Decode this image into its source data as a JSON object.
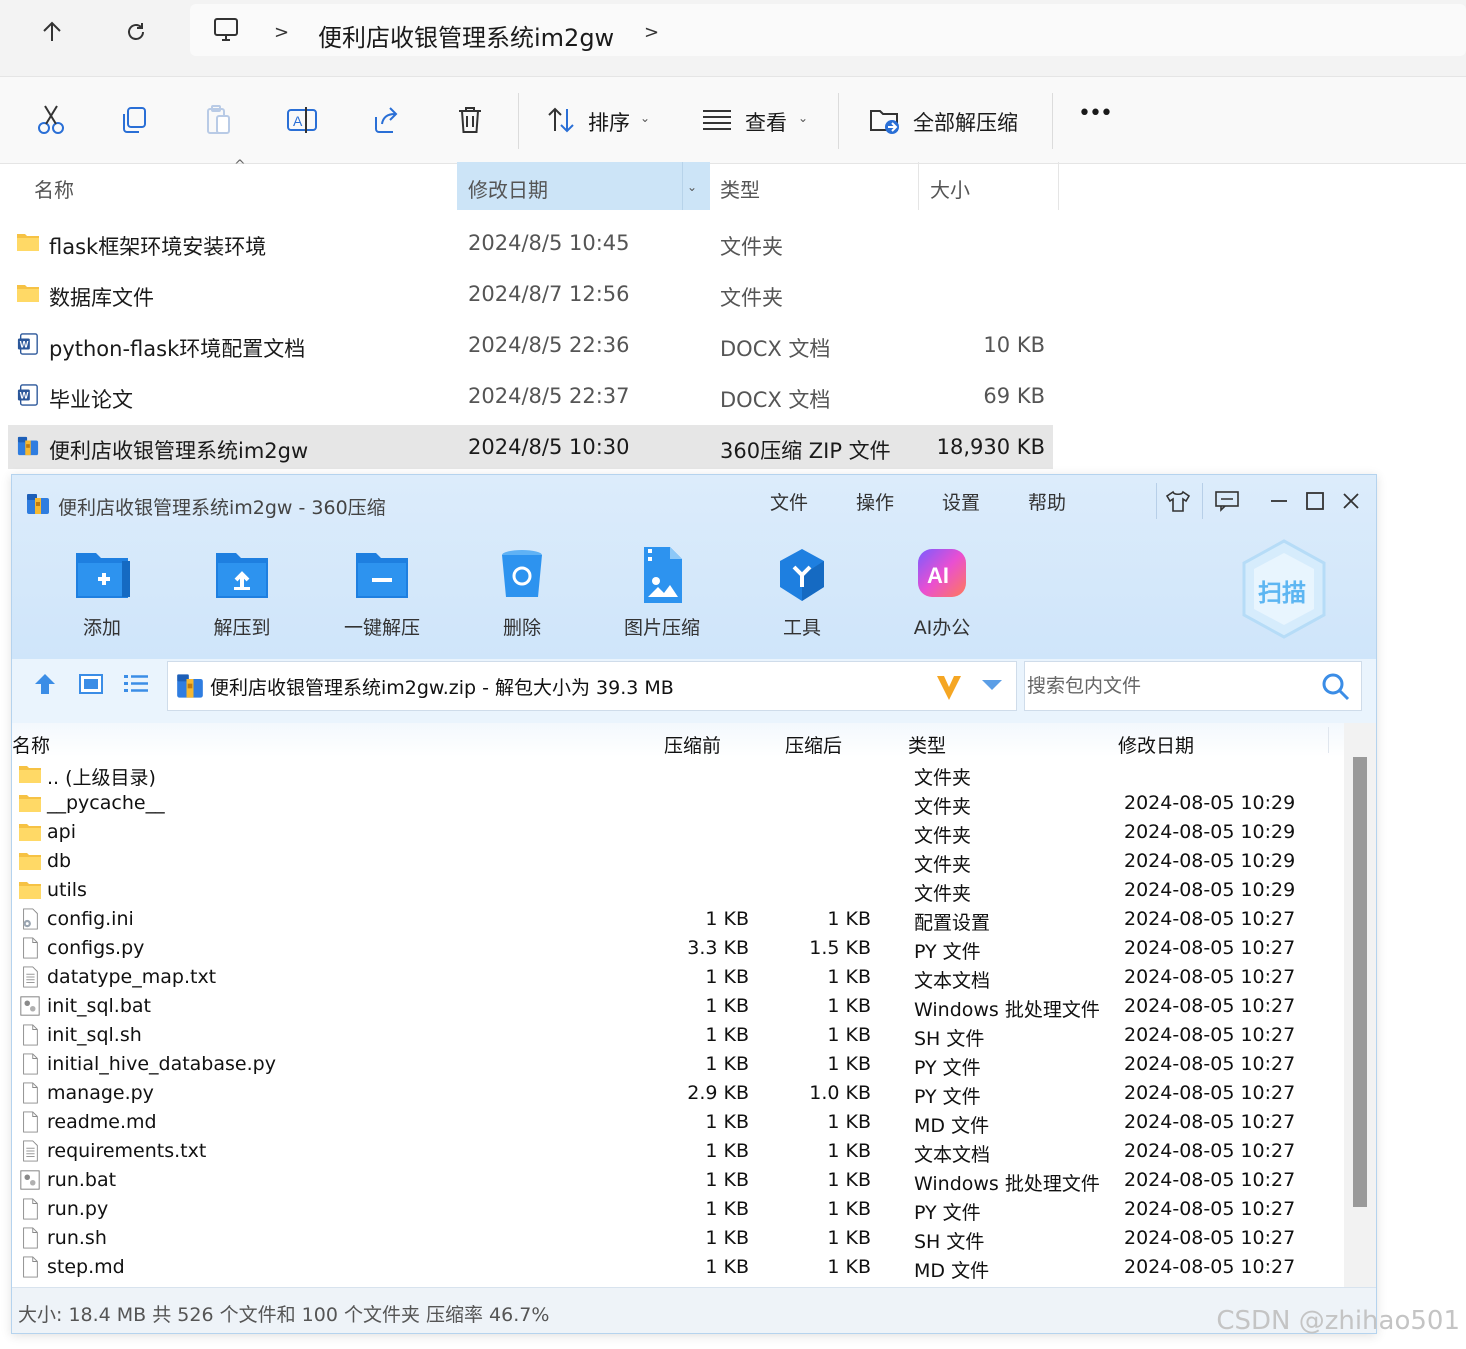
{
  "explorer": {
    "breadcrumb_title": "便利店收银管理系统im2gw",
    "toolbar": {
      "sort_label": "排序",
      "view_label": "查看",
      "extract_all_label": "全部解压缩",
      "more_label": "•••"
    },
    "columns": {
      "name": "名称",
      "date": "修改日期",
      "type": "类型",
      "size": "大小"
    },
    "rows": [
      {
        "name": "flask框架环境安装环境",
        "date": "2024/8/5 10:45",
        "type": "文件夹",
        "size": "",
        "icon": "folder-icon"
      },
      {
        "name": "数据库文件",
        "date": "2024/8/7 12:56",
        "type": "文件夹",
        "size": "",
        "icon": "folder-icon"
      },
      {
        "name": "python-flask环境配置文档",
        "date": "2024/8/5 22:36",
        "type": "DOCX 文档",
        "size": "10 KB",
        "icon": "word-doc-icon"
      },
      {
        "name": "毕业论文",
        "date": "2024/8/5 22:37",
        "type": "DOCX 文档",
        "size": "69 KB",
        "icon": "word-doc-icon"
      },
      {
        "name": "便利店收银管理系统im2gw",
        "date": "2024/8/5 10:30",
        "type": "360压缩 ZIP 文件",
        "size": "18,930 KB",
        "icon": "zip-archive-icon"
      }
    ]
  },
  "archive_window": {
    "title": "便利店收银管理系统im2gw - 360压缩",
    "menu": [
      "文件",
      "操作",
      "设置",
      "帮助"
    ],
    "tools": [
      {
        "label": "添加",
        "icon": "add-folder-icon"
      },
      {
        "label": "解压到",
        "icon": "extract-to-icon"
      },
      {
        "label": "一键解压",
        "icon": "one-click-extract-icon"
      },
      {
        "label": "删除",
        "icon": "delete-bin-icon"
      },
      {
        "label": "图片压缩",
        "icon": "image-compress-icon"
      },
      {
        "label": "工具",
        "icon": "tools-icon"
      },
      {
        "label": "AI办公",
        "icon": "ai-office-icon"
      }
    ],
    "scan_label": "扫描",
    "path_text": "便利店收银管理系统im2gw.zip - 解包大小为 39.3 MB",
    "search_placeholder": "搜索包内文件",
    "columns": {
      "name": "名称",
      "original": "压缩前",
      "compressed": "压缩后",
      "type": "类型",
      "date": "修改日期"
    },
    "files": [
      {
        "name": ".. (上级目录)",
        "orig": "",
        "comp": "",
        "type": "文件夹",
        "date": "",
        "icon": "folder-icon"
      },
      {
        "name": "__pycache__",
        "orig": "",
        "comp": "",
        "type": "文件夹",
        "date": "2024-08-05 10:29",
        "icon": "folder-icon"
      },
      {
        "name": "api",
        "orig": "",
        "comp": "",
        "type": "文件夹",
        "date": "2024-08-05 10:29",
        "icon": "folder-icon"
      },
      {
        "name": "db",
        "orig": "",
        "comp": "",
        "type": "文件夹",
        "date": "2024-08-05 10:29",
        "icon": "folder-icon"
      },
      {
        "name": "utils",
        "orig": "",
        "comp": "",
        "type": "文件夹",
        "date": "2024-08-05 10:29",
        "icon": "folder-icon"
      },
      {
        "name": "config.ini",
        "orig": "1 KB",
        "comp": "1 KB",
        "type": "配置设置",
        "date": "2024-08-05 10:27",
        "icon": "config-file-icon"
      },
      {
        "name": "configs.py",
        "orig": "3.3 KB",
        "comp": "1.5 KB",
        "type": "PY 文件",
        "date": "2024-08-05 10:27",
        "icon": "file-icon"
      },
      {
        "name": "datatype_map.txt",
        "orig": "1 KB",
        "comp": "1 KB",
        "type": "文本文档",
        "date": "2024-08-05 10:27",
        "icon": "text-file-icon"
      },
      {
        "name": "init_sql.bat",
        "orig": "1 KB",
        "comp": "1 KB",
        "type": "Windows 批处理文件",
        "date": "2024-08-05 10:27",
        "icon": "batch-file-icon"
      },
      {
        "name": "init_sql.sh",
        "orig": "1 KB",
        "comp": "1 KB",
        "type": "SH 文件",
        "date": "2024-08-05 10:27",
        "icon": "file-icon"
      },
      {
        "name": "initial_hive_database.py",
        "orig": "1 KB",
        "comp": "1 KB",
        "type": "PY 文件",
        "date": "2024-08-05 10:27",
        "icon": "file-icon"
      },
      {
        "name": "manage.py",
        "orig": "2.9 KB",
        "comp": "1.0 KB",
        "type": "PY 文件",
        "date": "2024-08-05 10:27",
        "icon": "file-icon"
      },
      {
        "name": "readme.md",
        "orig": "1 KB",
        "comp": "1 KB",
        "type": "MD 文件",
        "date": "2024-08-05 10:27",
        "icon": "file-icon"
      },
      {
        "name": "requirements.txt",
        "orig": "1 KB",
        "comp": "1 KB",
        "type": "文本文档",
        "date": "2024-08-05 10:27",
        "icon": "text-file-icon"
      },
      {
        "name": "run.bat",
        "orig": "1 KB",
        "comp": "1 KB",
        "type": "Windows 批处理文件",
        "date": "2024-08-05 10:27",
        "icon": "batch-file-icon"
      },
      {
        "name": "run.py",
        "orig": "1 KB",
        "comp": "1 KB",
        "type": "PY 文件",
        "date": "2024-08-05 10:27",
        "icon": "file-icon"
      },
      {
        "name": "run.sh",
        "orig": "1 KB",
        "comp": "1 KB",
        "type": "SH 文件",
        "date": "2024-08-05 10:27",
        "icon": "file-icon"
      },
      {
        "name": "step.md",
        "orig": "1 KB",
        "comp": "1 KB",
        "type": "MD 文件",
        "date": "2024-08-05 10:27",
        "icon": "file-icon"
      }
    ],
    "status": "大小: 18.4 MB 共 526 个文件和 100 个文件夹 压缩率 46.7%"
  },
  "watermark": "CSDN @zhihao501"
}
